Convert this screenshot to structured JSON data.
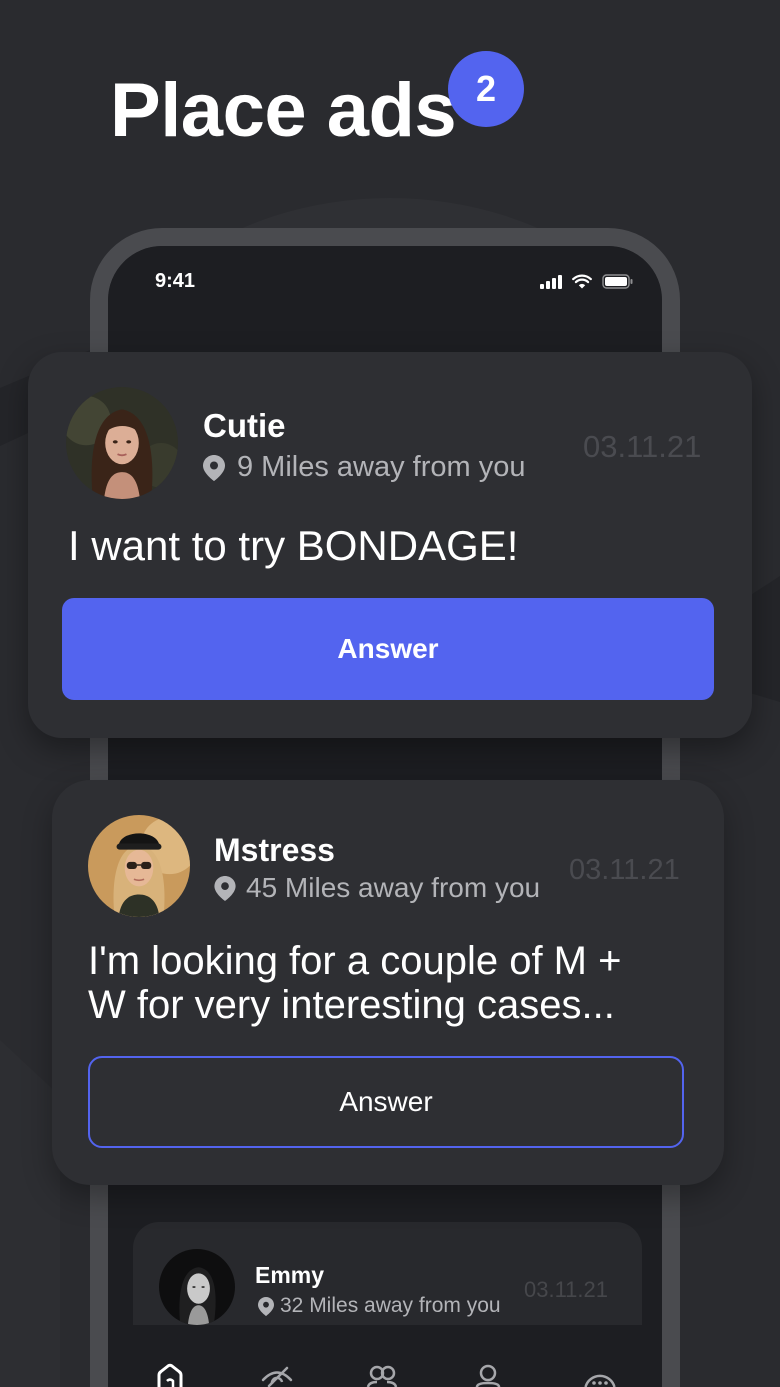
{
  "header": {
    "title": "Place ads",
    "badge": "2"
  },
  "theme": {
    "background": "#2a2b2f",
    "card": "#2e2f33",
    "mini": "#28292d",
    "accent": "#5364ef",
    "text": "#ffffff",
    "muted": "#b3b4b8",
    "date": "#4a4b50",
    "screen": "#1d1e22",
    "frame": "#4a4b4f",
    "inactive": "#a6a7ab"
  },
  "status_bar": {
    "time": "9:41",
    "icons": [
      "signal-icon",
      "wifi-icon",
      "battery-icon"
    ]
  },
  "ads": [
    {
      "name": "Cutie",
      "location_icon": "location-pin-icon",
      "distance": "9 Miles away from you",
      "date": "03.11.21",
      "message": "I want to try BONDAGE!",
      "answer_label": "Answer",
      "answer_filled": true
    },
    {
      "name": "Mstress",
      "location_icon": "location-pin-icon",
      "distance": "45 Miles away from you",
      "date": "03.11.21",
      "message": "I'm looking for a couple of M + W for very interesting cases...",
      "answer_label": "Answer",
      "answer_filled": false
    },
    {
      "name": "Emmy",
      "location_icon": "location-pin-icon",
      "distance": "32 Miles away from you",
      "date": "03.11.21"
    }
  ],
  "bottom_nav": {
    "items": [
      {
        "icon": "home-icon",
        "active": true
      },
      {
        "icon": "eye-off-icon",
        "active": false
      },
      {
        "icon": "users-icon",
        "active": false
      },
      {
        "icon": "profile-icon",
        "active": false
      },
      {
        "icon": "chat-icon",
        "active": false
      }
    ]
  }
}
